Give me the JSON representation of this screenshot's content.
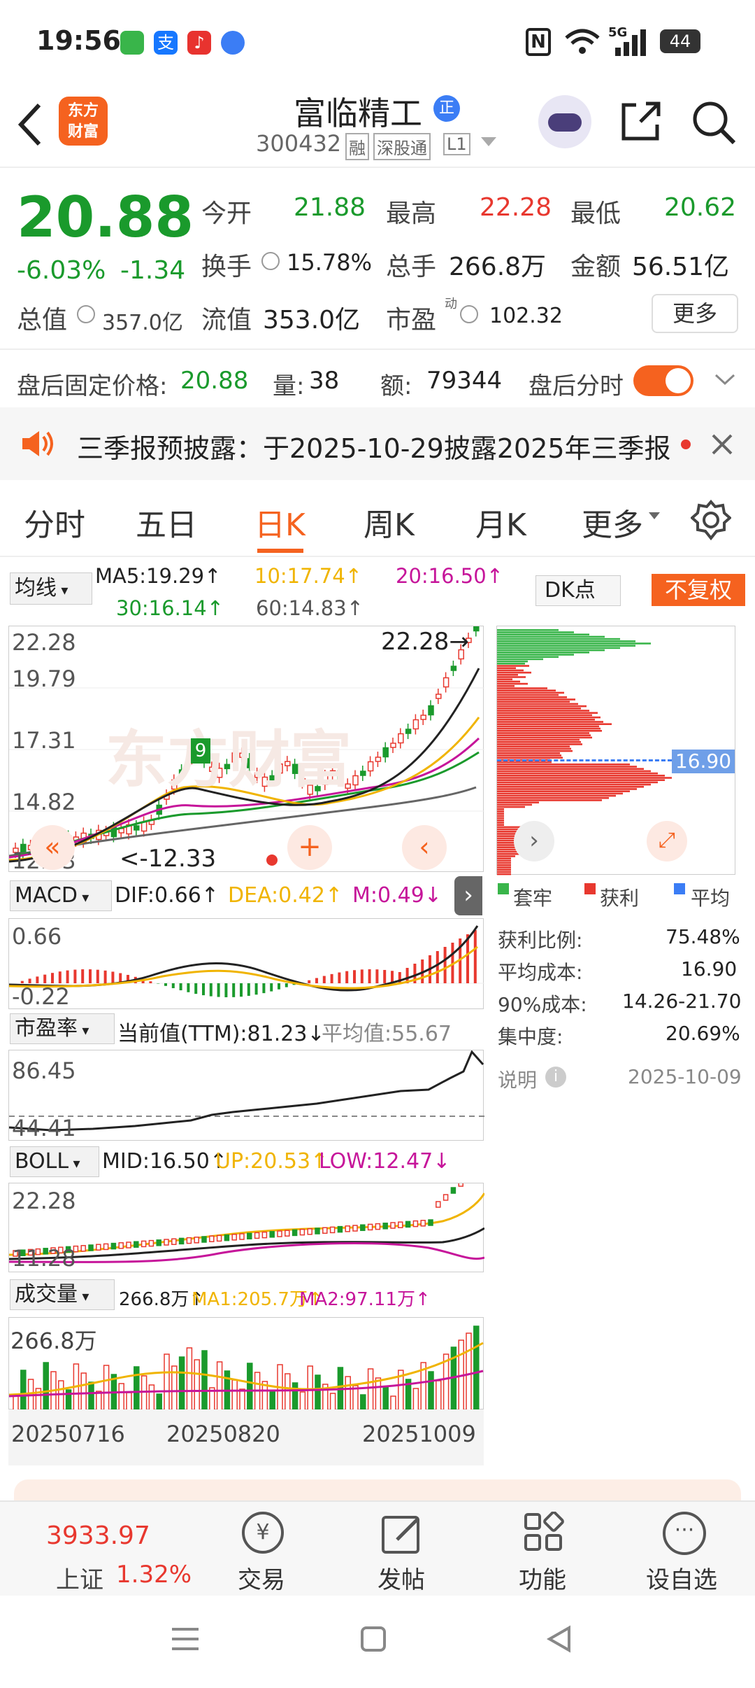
{
  "status": {
    "time": "19:56",
    "network": "5G",
    "battery": "44"
  },
  "header": {
    "stock_name": "富临精工",
    "badge": "正",
    "code": "300432",
    "tags": [
      "融",
      "深股通",
      "L1"
    ],
    "logo": [
      "东方",
      "财富"
    ]
  },
  "quote": {
    "price": "20.88",
    "change_pct": "-6.03%",
    "change": "-1.34",
    "open_label": "今开",
    "open": "21.88",
    "high_label": "最高",
    "high": "22.28",
    "low_label": "最低",
    "low": "20.62",
    "turnover_label": "换手",
    "turnover": "15.78%",
    "volume_label": "总手",
    "volume": "266.8万",
    "amount_label": "金额",
    "amount": "56.51亿",
    "mktcap_label": "总值",
    "mktcap": "357.0亿",
    "float_label": "流值",
    "float": "353.0亿",
    "pe_label": "市盈",
    "pe_sup": "动",
    "pe": "102.32",
    "more": "更多"
  },
  "after_hours": {
    "price_label": "盘后固定价格:",
    "price": "20.88",
    "vol_label": "量:",
    "vol": "38",
    "amt_label": "额:",
    "amt": "79344",
    "toggle_label": "盘后分时"
  },
  "notice": {
    "text": "三季报预披露：于2025-10-29披露2025年三季报"
  },
  "tabs": [
    "分时",
    "五日",
    "日K",
    "周K",
    "月K",
    "更多"
  ],
  "ma": {
    "selector": "均线",
    "ma5": "MA5:19.29↑",
    "ma10": "10:17.74↑",
    "ma20": "20:16.50↑",
    "ma30": "30:16.14↑",
    "ma60": "60:14.83↑",
    "dk": "DK点",
    "fq": "不复权"
  },
  "kline": {
    "y_labels": [
      "22.28",
      "19.79",
      "17.31",
      "14.82",
      "12.33"
    ],
    "high_mark": "22.28",
    "low_mark": "12.33",
    "watermark": "东方财富"
  },
  "chip": {
    "avg_tag": "16.90",
    "legend": [
      "套牢",
      "获利",
      "平均"
    ],
    "rows": [
      {
        "k": "获利比例:",
        "v": "75.48%"
      },
      {
        "k": "平均成本:",
        "v": "16.90"
      },
      {
        "k": "90%成本:",
        "v": "14.26-21.70"
      },
      {
        "k": "集中度:",
        "v": "20.69%"
      }
    ],
    "note": "说明",
    "date": "2025-10-09"
  },
  "macd": {
    "selector": "MACD",
    "dif": "DIF:0.66↑",
    "dea": "DEA:0.42↑",
    "m": "M:0.49↓",
    "top": "0.66",
    "bottom": "-0.22"
  },
  "pe_panel": {
    "selector": "市盈率",
    "current": "当前值(TTM):81.23↓",
    "avg": "平均值:55.67",
    "top": "86.45",
    "bottom": "44.41"
  },
  "boll": {
    "selector": "BOLL",
    "mid": "MID:16.50↑",
    "up": "UP:20.53↑",
    "low": "LOW:12.47↓",
    "top": "22.28",
    "bottom": "11.28"
  },
  "vol_panel": {
    "selector": "成交量",
    "val": "266.8万↑",
    "ma1": "MA1:205.7万↑",
    "ma2": "MA2:97.11万↑",
    "top": "266.8万",
    "dates": [
      "20250716",
      "20250820",
      "20251009"
    ]
  },
  "bottom_nav": {
    "index_value": "3933.97",
    "index_name": "上证",
    "index_pct": "1.32%",
    "items": [
      "交易",
      "发帖",
      "功能",
      "设自选"
    ]
  }
}
